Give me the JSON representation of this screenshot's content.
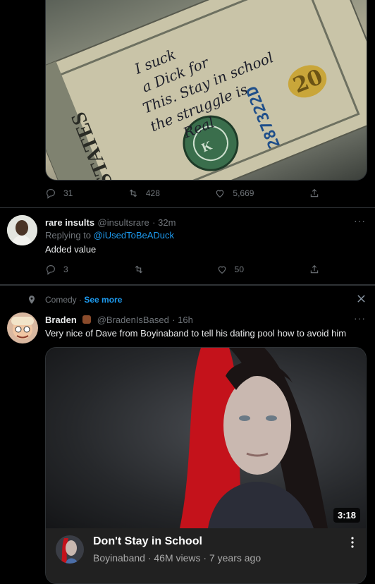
{
  "top_tweet": {
    "image_alt": "banknote-photo",
    "stats": {
      "replies": "31",
      "retweets": "428",
      "likes": "5,669"
    }
  },
  "reply_tweet": {
    "display_name": "rare insults",
    "handle": "@insultsrare",
    "time": "· 32m",
    "replying_to_label": "Replying to",
    "replying_to_handle": "@iUsedToBeADuck",
    "text": "Added value",
    "stats": {
      "replies": "3",
      "retweets": "",
      "likes": "50"
    }
  },
  "topic_header": {
    "topic": "Comedy",
    "see_more": "See more"
  },
  "comedy_tweet": {
    "display_name": "Braden",
    "handle": "@BradenIsBased",
    "time": "· 16h",
    "text": "Very nice of Dave from Boyinaband to tell his dating pool how to avoid him",
    "video": {
      "duration": "3:18",
      "title": "Don't Stay in School",
      "channel": "Boyinaband",
      "views": "· 46M views",
      "age": "· 7 years ago"
    }
  },
  "banknote_text": {
    "handwriting": [
      "I suck",
      "a Dick for",
      "This. Stay in school",
      "the struggle is",
      "Real"
    ],
    "serial": "287322D",
    "denomination": "20"
  }
}
